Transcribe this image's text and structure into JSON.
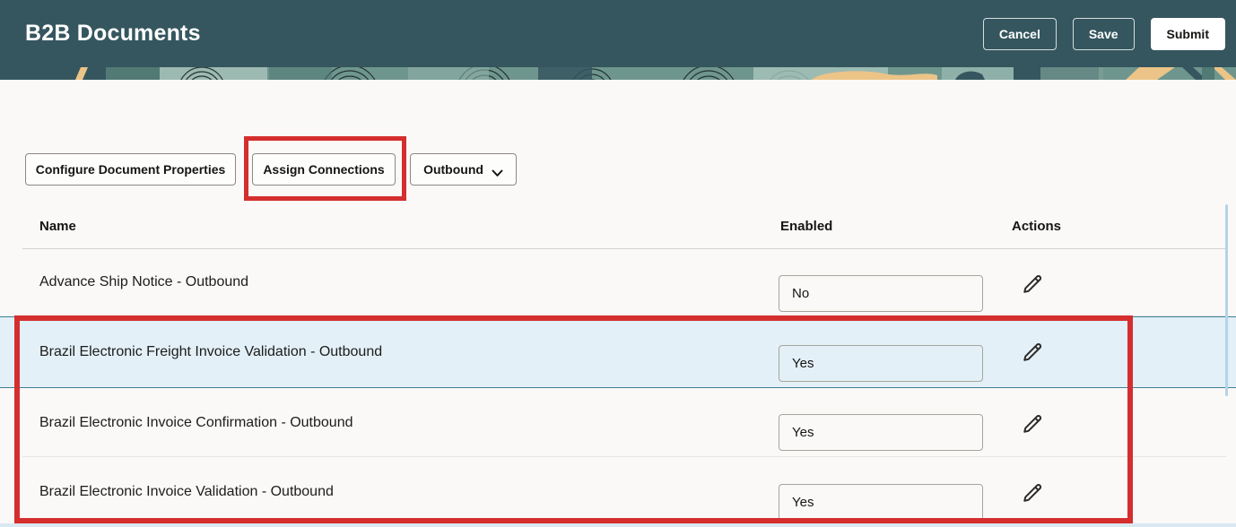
{
  "header": {
    "title": "B2B Documents",
    "cancel_label": "Cancel",
    "save_label": "Save",
    "submit_label": "Submit"
  },
  "toolbar": {
    "configure_label": "Configure Document Properties",
    "assign_label": "Assign Connections",
    "direction_dropdown": {
      "selected": "Outbound",
      "icon": "chevron-down-icon"
    }
  },
  "table": {
    "columns": [
      "Name",
      "Enabled",
      "Actions"
    ],
    "rows": [
      {
        "name": "Advance Ship Notice - Outbound",
        "enabled": "No",
        "highlighted": false
      },
      {
        "name": "Brazil Electronic Freight Invoice Validation - Outbound",
        "enabled": "Yes",
        "highlighted": true
      },
      {
        "name": "Brazil Electronic Invoice Confirmation - Outbound",
        "enabled": "Yes",
        "highlighted": false
      },
      {
        "name": "Brazil Electronic Invoice Validation - Outbound",
        "enabled": "Yes",
        "highlighted": false
      }
    ],
    "row_action_icon": "edit-pencil-icon"
  },
  "annotations": {
    "color": "#d42e2e",
    "targets": [
      "Assign Connections button",
      "Brazil document rows"
    ]
  },
  "colors": {
    "header_bg": "#35565e",
    "content_bg": "#faf9f8",
    "highlight_row_bg": "#e3f0f8",
    "highlight_row_border": "#3d7f98",
    "annotation_red": "#d42e2e",
    "banner_sage": "#6e968e",
    "banner_tan": "#ecc487"
  }
}
